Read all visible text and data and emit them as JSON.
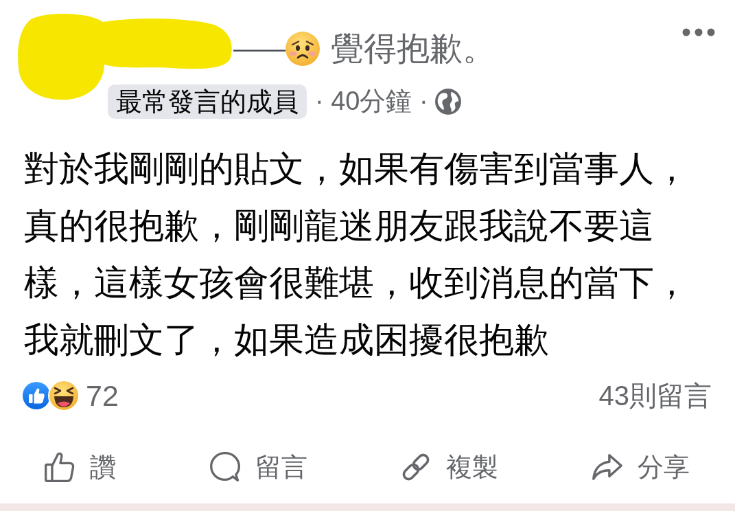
{
  "post": {
    "header": {
      "status_dash": "——",
      "feeling": "覺得抱歉。",
      "member_badge": "最常發言的成員",
      "time": "· 40分鐘 ·"
    },
    "body_lines": [
      "對於我剛剛的貼文，如果有傷害到當事人，",
      "真的很抱歉，剛剛龍迷朋友跟我說不要這",
      "樣，這樣女孩會很難堪，收到消息的當下，",
      "我就刪文了，如果造成困擾很抱歉"
    ],
    "reactions": {
      "count": "72",
      "comments": "43則留言"
    },
    "actions": [
      {
        "kind": "like",
        "label": "讚"
      },
      {
        "kind": "comment",
        "label": "留言"
      },
      {
        "kind": "copy",
        "label": "複製"
      },
      {
        "kind": "share",
        "label": "分享"
      }
    ]
  }
}
